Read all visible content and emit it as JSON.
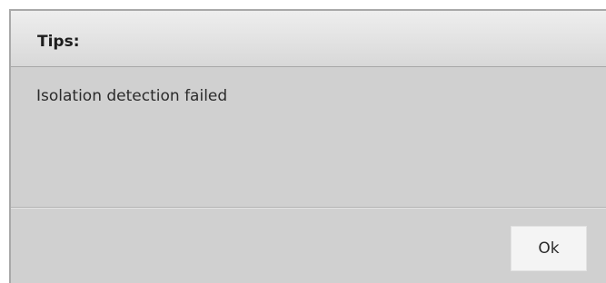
{
  "dialog": {
    "title": "Tips:",
    "message": "Isolation detection failed",
    "ok_label": "Ok"
  }
}
